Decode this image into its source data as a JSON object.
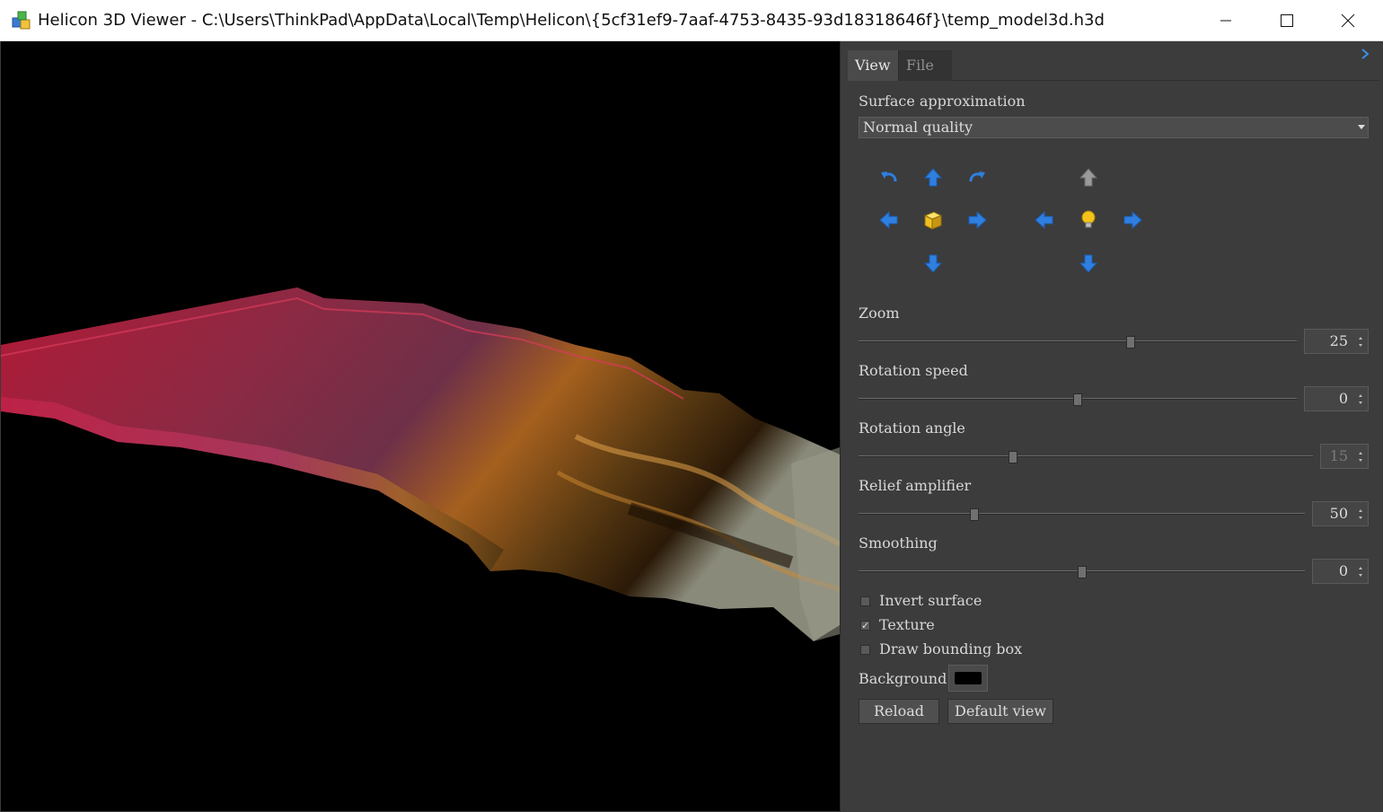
{
  "window": {
    "title": "Helicon 3D Viewer - C:\\Users\\ThinkPad\\AppData\\Local\\Temp\\Helicon\\{5cf31ef9-7aaf-4753-8435-93d18318646f}\\temp_model3d.h3d",
    "minimize_icon": "minimize-icon",
    "maximize_icon": "maximize-icon",
    "close_icon": "close-icon"
  },
  "tabs": [
    {
      "label": "View",
      "active": true
    },
    {
      "label": "File",
      "active": false
    }
  ],
  "surface": {
    "label": "Surface approximation",
    "selected": "Normal quality"
  },
  "controls": {
    "model": [
      "rotate-left-icon",
      "move-up-icon",
      "rotate-right-icon",
      "move-left-icon",
      "cube-icon",
      "move-right-icon",
      "move-down-icon"
    ],
    "light": [
      "light-up-icon",
      "light-left-icon",
      "bulb-icon",
      "light-right-icon",
      "light-down-icon"
    ]
  },
  "sliders": {
    "zoom": {
      "label": "Zoom",
      "value": "25",
      "level": 0.62
    },
    "rotation_speed": {
      "label": "Rotation speed",
      "value": "0",
      "level": 0.5
    },
    "rotation_angle": {
      "label": "Rotation angle",
      "value": "15",
      "level": 0.34,
      "disabled": true
    },
    "relief_amplifier": {
      "label": "Relief amplifier",
      "value": "50",
      "level": 0.26
    },
    "smoothing": {
      "label": "Smoothing",
      "value": "0",
      "level": 0.5
    }
  },
  "options": {
    "invert_surface": {
      "label": "Invert surface",
      "checked": false
    },
    "texture": {
      "label": "Texture",
      "checked": true,
      "mark": "✓"
    },
    "bounding_box": {
      "label": "Draw bounding box",
      "checked": false
    }
  },
  "background": {
    "label": "Background",
    "color": "#000000"
  },
  "buttons": {
    "reload": "Reload",
    "default_view": "Default view"
  },
  "colors": {
    "accent_blue": "#2e7fe0",
    "bulb_yellow": "#f4c21a",
    "panel_bg": "#3c3c3c"
  }
}
